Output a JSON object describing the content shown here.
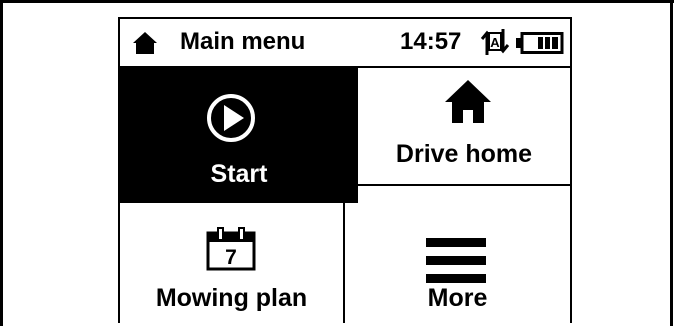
{
  "statusbar": {
    "title": "Main menu",
    "time": "14:57",
    "home_icon": "home-icon",
    "mode_icon": "auto-mode-icon",
    "mode_letter": "A",
    "battery_icon": "battery-icon"
  },
  "tiles": {
    "start": {
      "label": "Start",
      "icon": "play-icon"
    },
    "drive_home": {
      "label": "Drive home",
      "icon": "house-icon"
    },
    "mowing_plan": {
      "label": "Mowing plan",
      "icon": "calendar-icon",
      "day": "7"
    },
    "more": {
      "label": "More",
      "icon": "menu-icon"
    }
  },
  "colors": {
    "selected_bg": "#000000",
    "foreground": "#000000",
    "background": "#ffffff"
  }
}
